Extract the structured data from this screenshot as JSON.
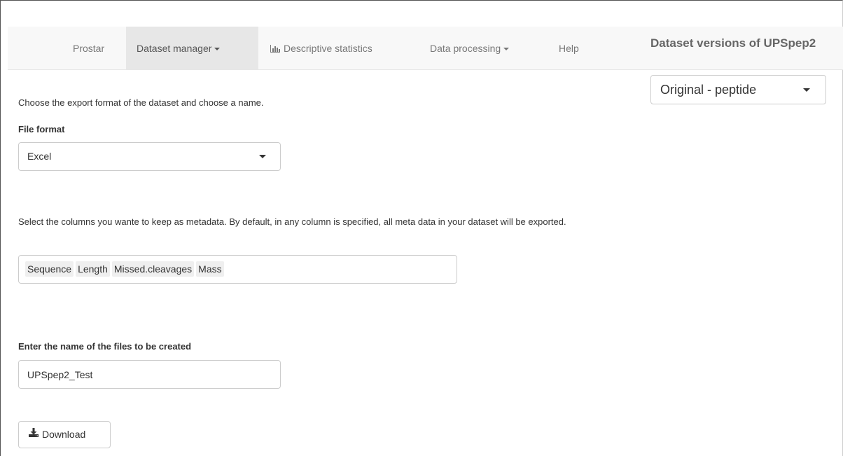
{
  "navbar": {
    "items": [
      {
        "label": "Prostar",
        "active": false,
        "dropdown": false
      },
      {
        "label": "Dataset manager",
        "active": true,
        "dropdown": true
      },
      {
        "label": "Descriptive statistics",
        "active": false,
        "dropdown": false,
        "icon": "bar-chart-icon"
      },
      {
        "label": "Data processing",
        "active": false,
        "dropdown": true
      },
      {
        "label": "Help",
        "active": false,
        "dropdown": false
      }
    ]
  },
  "dataset_versions": {
    "title": "Dataset versions of UPSpep2",
    "selected": "Original - peptide"
  },
  "export": {
    "intro": "Choose the export format of the dataset and choose a name.",
    "file_format_label": "File format",
    "file_format_value": "Excel",
    "columns_help": "Select the columns you wante to keep as metadata. By default, in any column is specified, all meta data in your dataset will be exported.",
    "selected_columns": [
      "Sequence",
      "Length",
      "Missed.cleavages",
      "Mass"
    ],
    "filename_label": "Enter the name of the files to be created",
    "filename_value": "UPSpep2_Test",
    "download_label": "Download"
  },
  "colors": {
    "navbar_bg": "#f8f8f8",
    "navbar_active_bg": "#e7e7e7",
    "nav_text": "#777777",
    "tag_bg": "#efefef",
    "border": "#cccccc"
  }
}
